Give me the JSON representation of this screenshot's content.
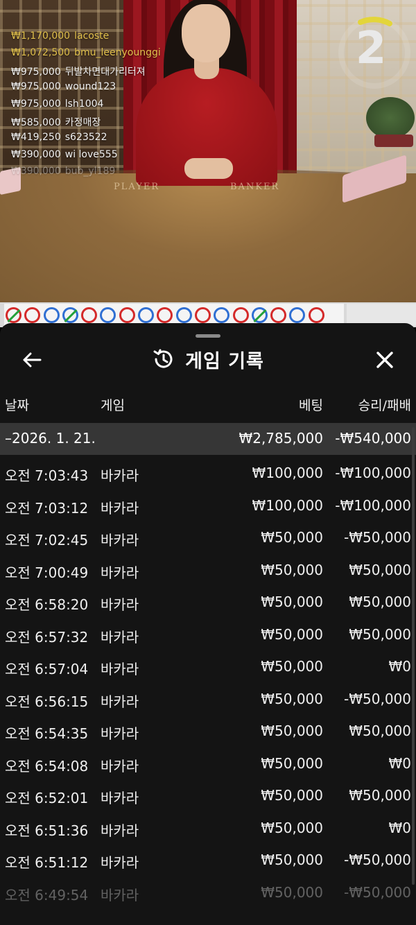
{
  "stream": {
    "timer": "2",
    "felt_player": "PLAYER",
    "felt_banker": "BANKER",
    "bet_feed": [
      {
        "amount": "₩1,170,000",
        "user": "lacoste",
        "highlight": true
      },
      {
        "amount": "₩1,072,500",
        "user": "bmu_leenyounggi",
        "highlight": true
      },
      {
        "amount": "₩975,000",
        "user": "뒤발차면대가리터져",
        "highlight": false
      },
      {
        "amount": "₩975,000",
        "user": "wound123",
        "highlight": false
      },
      {
        "amount": "₩975,000",
        "user": "lsh1004",
        "highlight": false
      },
      {
        "amount": "₩585,000",
        "user": "카정매장",
        "highlight": false
      },
      {
        "amount": "₩419,250",
        "user": "s623522",
        "highlight": false
      },
      {
        "amount": "₩390,000",
        "user": "wi love555",
        "highlight": false
      },
      {
        "amount": "₩390,000",
        "user": "bub_yl189",
        "highlight": false
      }
    ]
  },
  "bead_road": [
    "b-t",
    "b",
    "p",
    "p-t",
    "b",
    "p",
    "b",
    "p",
    "b",
    "p",
    "b",
    "p",
    "b",
    "p-t",
    "b",
    "p",
    "b"
  ],
  "colors": {
    "player": "#2f6fd3",
    "banker": "#d42a2a",
    "tie": "#25a13a",
    "highlight_text": "#e2c14c",
    "sheet_bg": "#141414",
    "summary_bg": "#363636"
  },
  "icons": {
    "back": "arrow-left-icon",
    "history": "history-icon",
    "close": "close-icon"
  },
  "history": {
    "title": "게임 기록",
    "columns": {
      "date": "날짜",
      "game": "게임",
      "bet": "베팅",
      "result": "승리/패배"
    },
    "summary": {
      "date": "–2026. 1. 21.",
      "bet": "₩2,785,000",
      "result": "-₩540,000"
    },
    "rows": [
      {
        "time": "오전 7:03:43",
        "game": "바카라",
        "bet": "₩100,000",
        "result": "-₩100,000"
      },
      {
        "time": "오전 7:03:12",
        "game": "바카라",
        "bet": "₩100,000",
        "result": "-₩100,000"
      },
      {
        "time": "오전 7:02:45",
        "game": "바카라",
        "bet": "₩50,000",
        "result": "-₩50,000"
      },
      {
        "time": "오전 7:00:49",
        "game": "바카라",
        "bet": "₩50,000",
        "result": "₩50,000"
      },
      {
        "time": "오전 6:58:20",
        "game": "바카라",
        "bet": "₩50,000",
        "result": "₩50,000"
      },
      {
        "time": "오전 6:57:32",
        "game": "바카라",
        "bet": "₩50,000",
        "result": "₩50,000"
      },
      {
        "time": "오전 6:57:04",
        "game": "바카라",
        "bet": "₩50,000",
        "result": "₩0"
      },
      {
        "time": "오전 6:56:15",
        "game": "바카라",
        "bet": "₩50,000",
        "result": "-₩50,000"
      },
      {
        "time": "오전 6:54:35",
        "game": "바카라",
        "bet": "₩50,000",
        "result": "₩50,000"
      },
      {
        "time": "오전 6:54:08",
        "game": "바카라",
        "bet": "₩50,000",
        "result": "₩0"
      },
      {
        "time": "오전 6:52:01",
        "game": "바카라",
        "bet": "₩50,000",
        "result": "₩50,000"
      },
      {
        "time": "오전 6:51:36",
        "game": "바카라",
        "bet": "₩50,000",
        "result": "₩0"
      },
      {
        "time": "오전 6:51:12",
        "game": "바카라",
        "bet": "₩50,000",
        "result": "-₩50,000"
      },
      {
        "time": "오전 6:49:54",
        "game": "바카라",
        "bet": "₩50,000",
        "result": "-₩50,000"
      }
    ]
  }
}
